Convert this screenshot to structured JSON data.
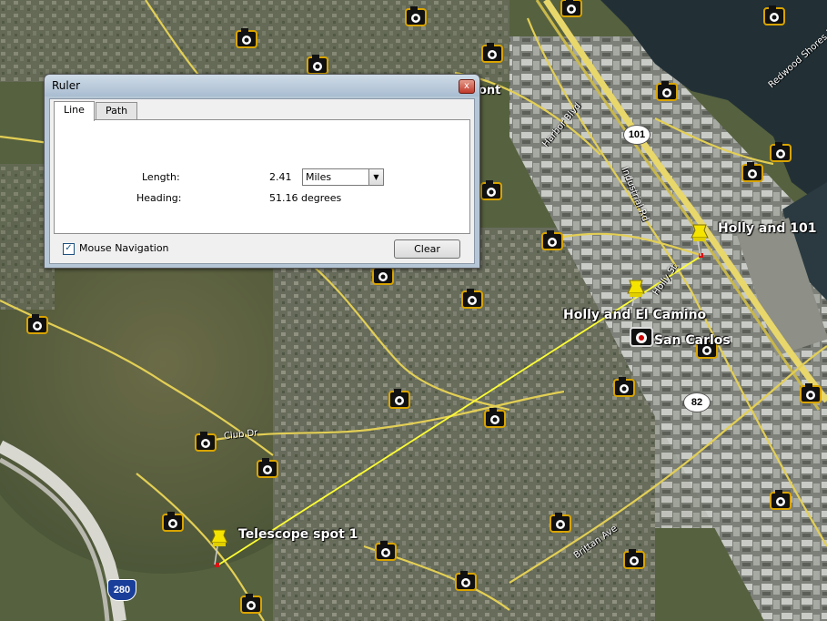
{
  "ruler": {
    "title": "Ruler",
    "close_symbol": "x",
    "tabs": [
      {
        "label": "Line",
        "active": true
      },
      {
        "label": "Path",
        "active": false
      }
    ],
    "length_label": "Length:",
    "length_value": "2.41",
    "unit_selected": "Miles",
    "heading_label": "Heading:",
    "heading_value": "51.16 degrees",
    "mouse_navigation_label": "Mouse Navigation",
    "mouse_navigation_checked": true,
    "clear_label": "Clear"
  },
  "placemarks": {
    "telescope": "Telescope spot 1",
    "holly_101": "Holly and 101",
    "holly_el_camino": "Holly and El Camino",
    "san_carlos": "San Carlos"
  },
  "roads": {
    "harbor_blvd": "Harbor Blvd",
    "industrial_rd": "Industrial Rd",
    "holly_st": "Holly St",
    "club_dr": "Club Dr",
    "brittan_ave": "Brittan Ave",
    "redwood_shores": "Redwood Shores Pkwy",
    "partial_top_left": "ont"
  },
  "shields": {
    "us101": "101",
    "ca82": "82",
    "i280": "280"
  },
  "colors": {
    "ruler_line": "#ffff33",
    "pushpin": "#f5e400",
    "road": "#e6d35a",
    "satellite_base": "#5d6a4b"
  },
  "icons": [
    "photo-camera-icon",
    "pushpin-icon",
    "close-icon",
    "dropdown-arrow-icon",
    "checkbox-icon"
  ]
}
